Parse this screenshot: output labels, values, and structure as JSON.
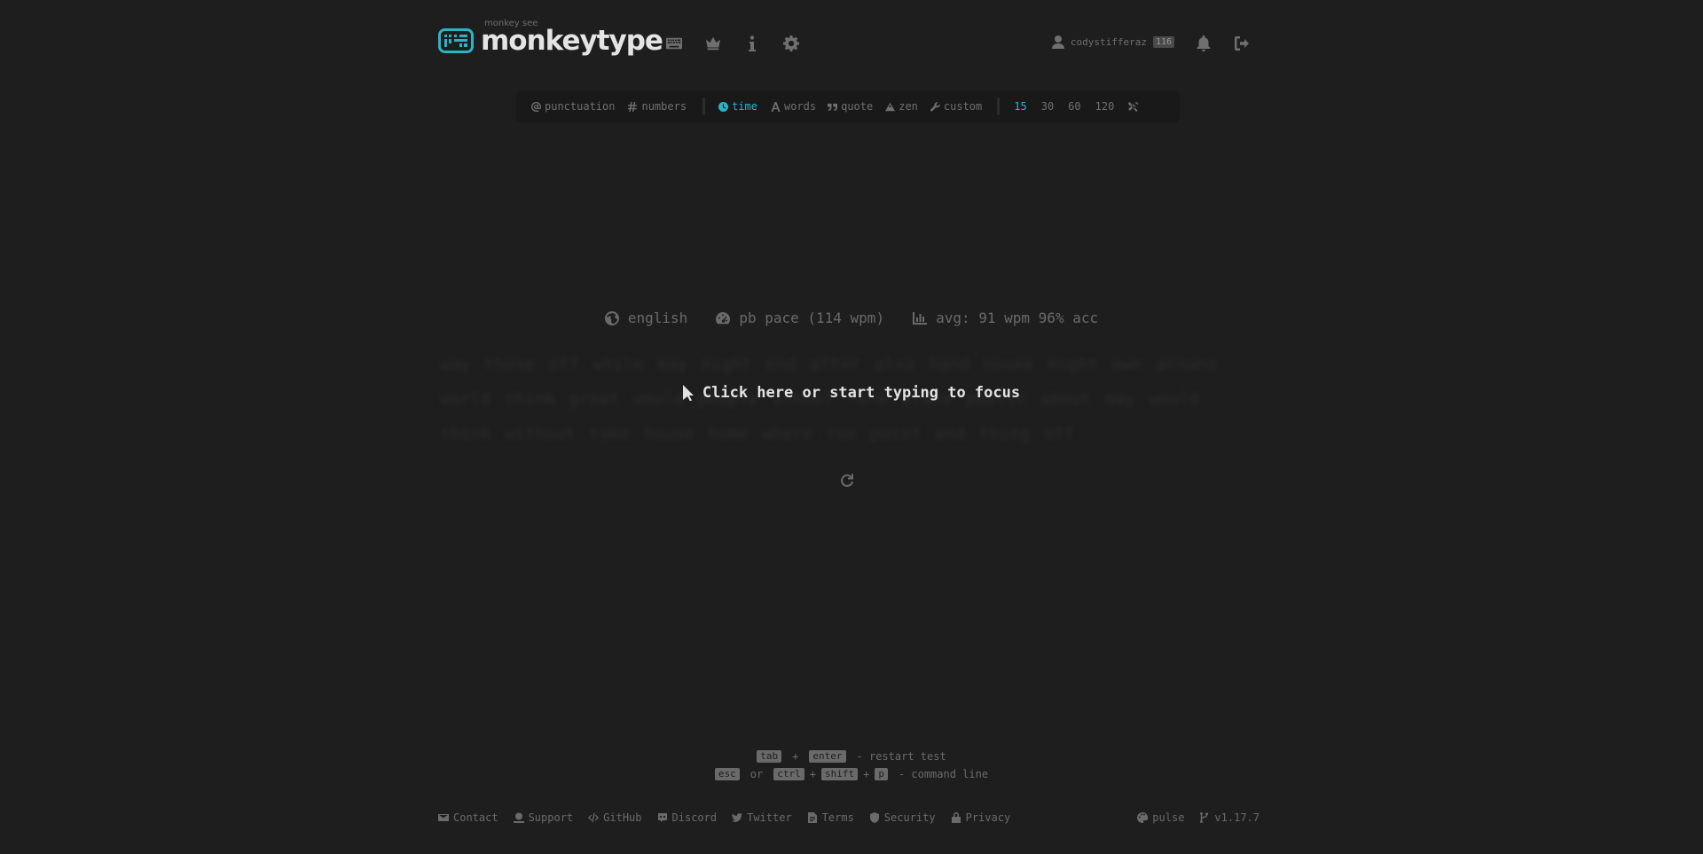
{
  "header": {
    "logo_top_text": "monkey see",
    "logo_text": "monkeytype",
    "nav_icons": [
      "keyboard-icon",
      "crown-icon",
      "info-icon",
      "gear-icon"
    ],
    "username": "codystifferaz",
    "level": "116"
  },
  "config": {
    "punctuation": "punctuation",
    "numbers": "numbers",
    "time": "time",
    "words": "words",
    "quote": "quote",
    "zen": "zen",
    "custom": "custom",
    "durations": [
      "15",
      "30",
      "60",
      "120"
    ],
    "active_mode": "time",
    "active_duration": "15"
  },
  "info": {
    "language": "english",
    "pace": "pb pace (114 wpm)",
    "average": "avg: 91 wpm 96% acc"
  },
  "words_blurred": "way those off while may might end after also hand house might own around world think great would people school form state public about may would think without take house home where run point end thing off",
  "focus_message": "Click here or start typing to focus",
  "hints": {
    "restart_keys": [
      "tab",
      "enter"
    ],
    "restart_plus": "+",
    "restart_text": "- restart test",
    "command_key1": "esc",
    "command_or": "or",
    "command_keys": [
      "ctrl",
      "shift",
      "p"
    ],
    "command_plus": "+",
    "command_text": "- command line"
  },
  "footer": {
    "links": [
      "Contact",
      "Support",
      "GitHub",
      "Discord",
      "Twitter",
      "Terms",
      "Security",
      "Privacy"
    ],
    "theme": "pulse",
    "version": "v1.17.7"
  },
  "colors": {
    "background": "#1e1e1e",
    "accent": "#2cb3c6",
    "text": "#e2e2e2",
    "sub": "#6f6f6f"
  }
}
